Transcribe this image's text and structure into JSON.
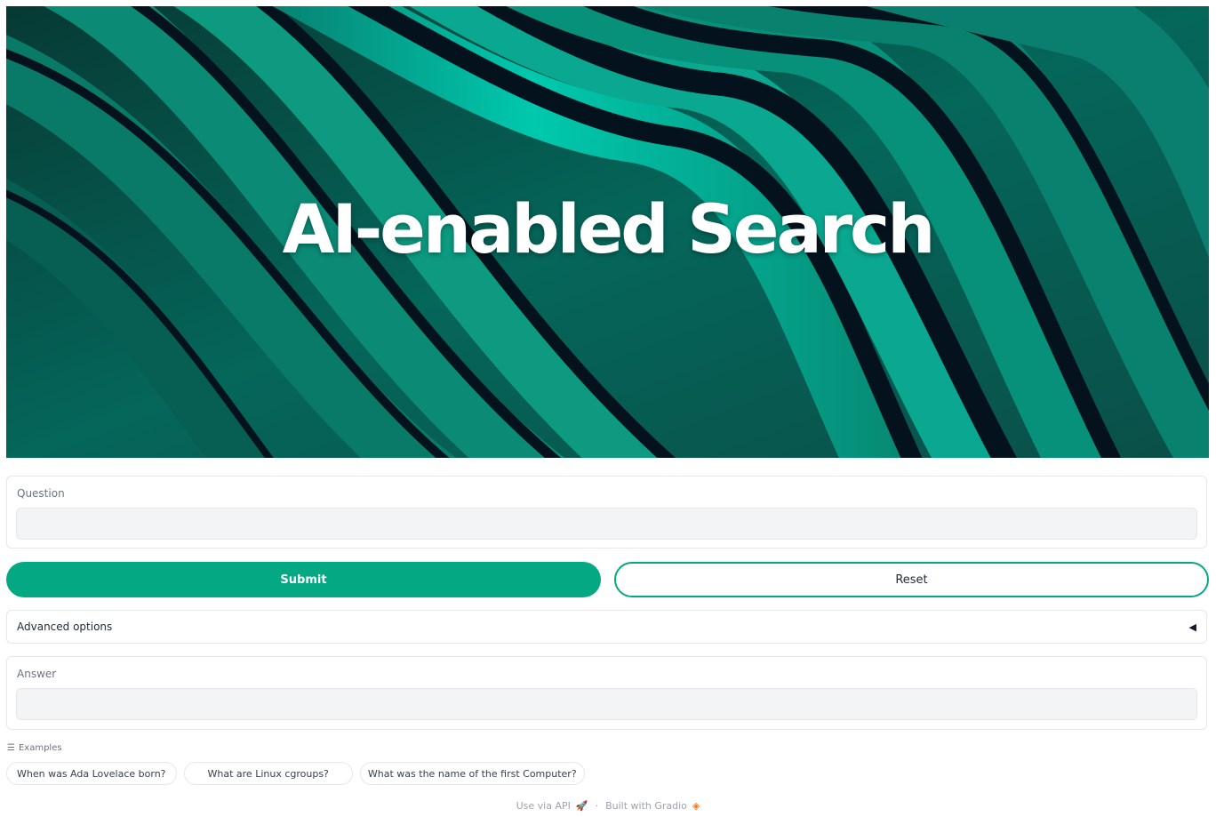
{
  "banner": {
    "title": "AI-enabled Search",
    "colors": {
      "dark": "#03121c",
      "mid": "#05665a",
      "bright": "#00c9ae"
    }
  },
  "question": {
    "label": "Question",
    "value": "",
    "placeholder": ""
  },
  "buttons": {
    "submit_label": "Submit",
    "reset_label": "Reset",
    "accent": "#04a882"
  },
  "advanced": {
    "label": "Advanced options",
    "caret_icon": "caret-left-icon"
  },
  "answer": {
    "label": "Answer",
    "value": "",
    "placeholder": ""
  },
  "examples": {
    "label": "Examples",
    "icon": "list-icon",
    "items": [
      "When was Ada Lovelace born?",
      "What are Linux cgroups?",
      "What was the name of the first Computer?"
    ]
  },
  "footer": {
    "api_label": "Use via API",
    "separator": "·",
    "built_label": "Built with Gradio"
  }
}
